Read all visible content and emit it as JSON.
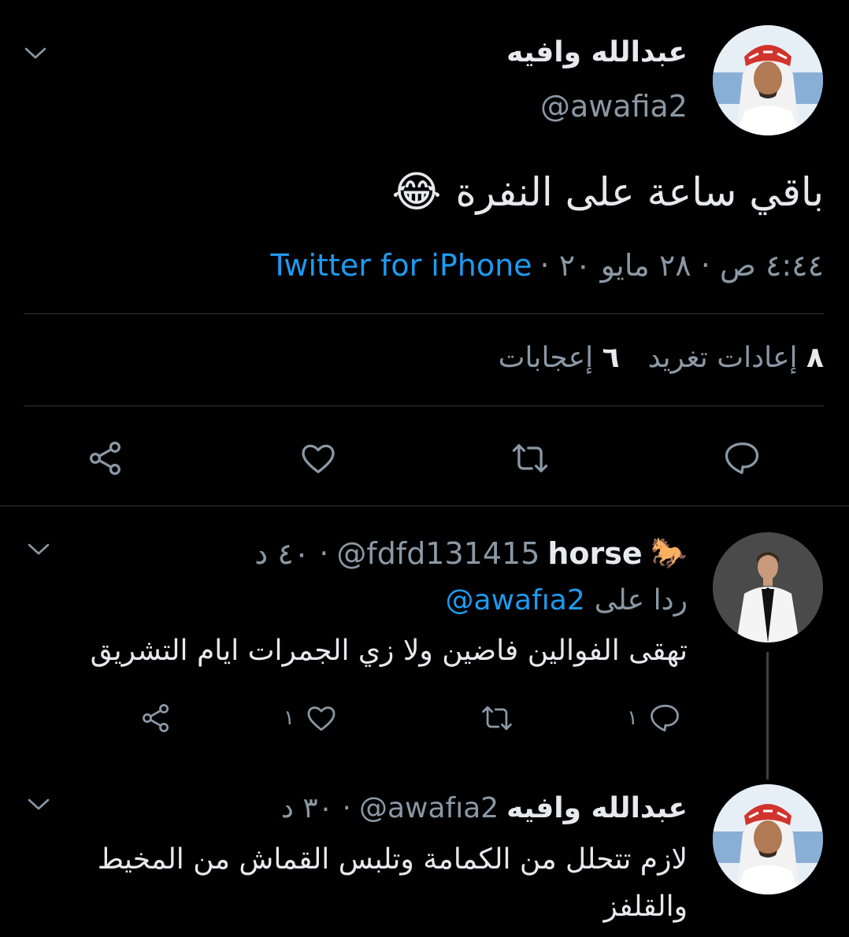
{
  "main_tweet": {
    "display_name": "عبدالله وافيه",
    "handle": "@awafia2",
    "text": "باقي ساعة على النفرة",
    "emoji": "😂",
    "time_date": "٤:٤٤ ص · ٢٨ مايو ٢٠ ·",
    "source": "Twitter for iPhone",
    "retweets_count": "٨",
    "retweets_label": "إعادات تغريد",
    "likes_count": "٦",
    "likes_label": "إعجابات"
  },
  "reply1": {
    "emoji": "🐎",
    "display_name": "horse",
    "handle": "@fdfd131415",
    "time": "· ٤٠ د",
    "replying_prefix": "ردا على",
    "replying_handle": "@awafıa2",
    "text": "تهقى الفوالين فاضين ولا زي الجمرات ايام التشريق",
    "reply_count": "١",
    "like_count": "١"
  },
  "reply2": {
    "display_name": "عبدالله وافيه",
    "handle": "@awafıa2",
    "time": "· ٣٠ د",
    "text": "لازم تتحلل من الكمامة وتلبس القماش من المخيط والقلفز"
  },
  "colors": {
    "background": "#000000",
    "text": "#e7e9ea",
    "muted": "#8b98a5",
    "accent": "#1d9bf0",
    "divider": "#2f3336"
  }
}
